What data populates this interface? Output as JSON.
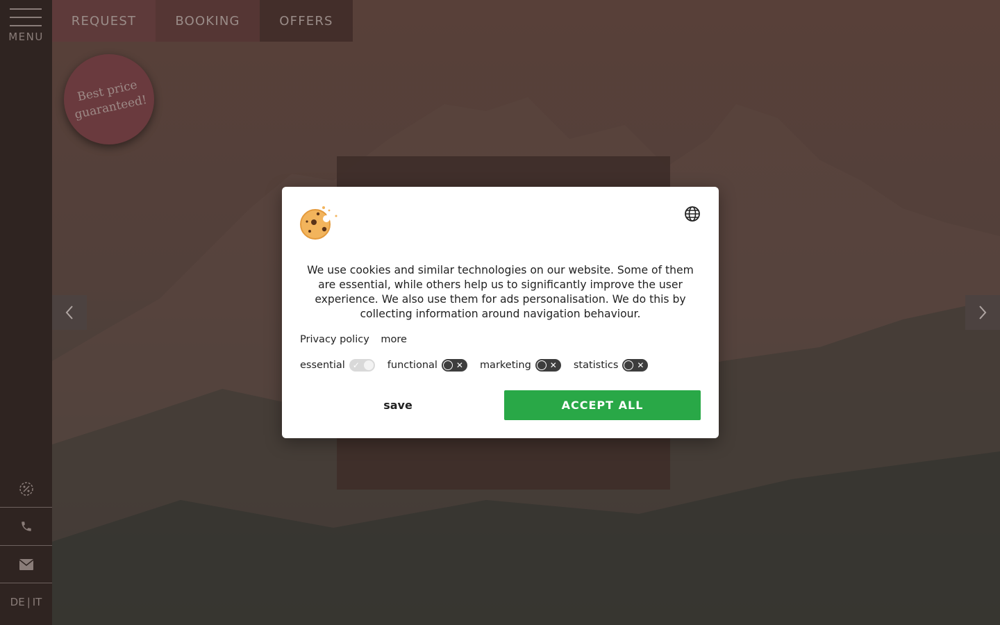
{
  "nav": {
    "menu_label": "MENU",
    "tabs": [
      "REQUEST",
      "BOOKING",
      "OFFERS"
    ]
  },
  "badge": {
    "line1": "Best price",
    "line2": "guaranteed!"
  },
  "sidebar": {
    "icons": [
      "offers-percent-icon",
      "phone-icon",
      "mail-icon"
    ],
    "lang": {
      "de": "DE",
      "separator": "|",
      "it": "IT"
    }
  },
  "cookie_dialog": {
    "text": "We use cookies and similar technologies on our website. Some of them are essential, while others help us to significantly improve the user experience. We also use them for ads personalisation. We do this by collecting information around navigation behaviour.",
    "links": {
      "privacy": "Privacy policy",
      "more": "more"
    },
    "toggles": {
      "essential": "essential",
      "functional": "functional",
      "marketing": "marketing",
      "statistics": "statistics"
    },
    "save_label": "save",
    "accept_label": "ACCEPT ALL"
  },
  "colors": {
    "accept": "#29a847",
    "sidebar": "#2f2421",
    "badge": "#6a3a3e"
  }
}
